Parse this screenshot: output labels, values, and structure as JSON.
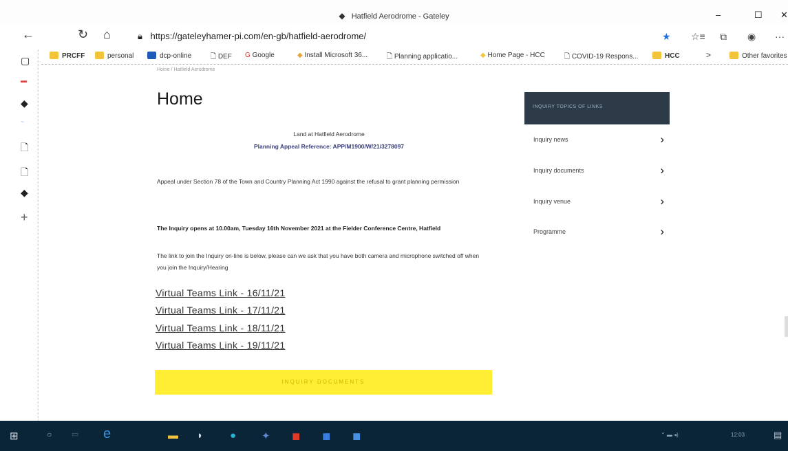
{
  "window": {
    "title": "Hatfield Aerodrome - Gateley",
    "controls": {
      "minimize": "–",
      "maximize": "☐",
      "close": "✕"
    }
  },
  "addressbar": {
    "back": "←",
    "reload": "↻",
    "home": "⌂",
    "url": "https://gateleyhamer-pi.com/en-gb/hatfield-aerodrome/",
    "star": "★",
    "collections": "☆≡",
    "more": "···"
  },
  "favorites": [
    {
      "label": "PRCFF",
      "color": "#f3c43a"
    },
    {
      "label": "personal",
      "color": "#f3c43a"
    },
    {
      "label": "dcp-online",
      "color": "#1e5bb8"
    },
    {
      "label": "DEF",
      "color": "#ffffff"
    },
    {
      "label": "Google",
      "color": "#ffffff"
    },
    {
      "label": "Install Microsoft 36...",
      "color": "#f3c43a"
    },
    {
      "label": "Planning applicatio...",
      "color": "#ffffff"
    },
    {
      "label": "Home Page - HCC",
      "color": "#f3c43a"
    },
    {
      "label": "COVID-19 Respons...",
      "color": "#ffffff"
    },
    {
      "label": "HCC",
      "color": "#f3c43a"
    },
    {
      "label": "Other favorites",
      "color": "#f3c43a"
    }
  ],
  "favorites_more": ">",
  "page": {
    "breadcrumb": "Home / Hatfield Aerodrome",
    "title": "Home",
    "land_line": "Land at Hatfield Aerodrome",
    "appeal_ref": "Planning Appeal Reference: APP/M1900/W/21/3278097",
    "appeal_text": "Appeal under Section 78 of the Town and Country Planning Act 1990 against the refusal to grant planning permission",
    "inquiry_opens": "The Inquiry opens at 10.00am, Tuesday 16th November 2021 at the Fielder Conference Centre, Hatfield",
    "link_text": "The link to join the Inquiry on-line is below, please can we ask that you have both camera and microphone switched off when you join the Inquiry/Hearing",
    "links": [
      "Virtual Teams Link - 16/11/21",
      "Virtual Teams Link - 17/11/21",
      "Virtual Teams Link - 18/11/21",
      "Virtual Teams Link - 19/11/21"
    ],
    "yellow_button": "INQUIRY DOCUMENTS"
  },
  "side_panel": {
    "header": "INQUIRY TOPICS OF LINKS",
    "items": [
      "Inquiry news",
      "Inquiry documents",
      "Inquiry venue",
      "Programme"
    ],
    "chevron": "›"
  },
  "taskbar": {
    "clock": "12:03"
  }
}
